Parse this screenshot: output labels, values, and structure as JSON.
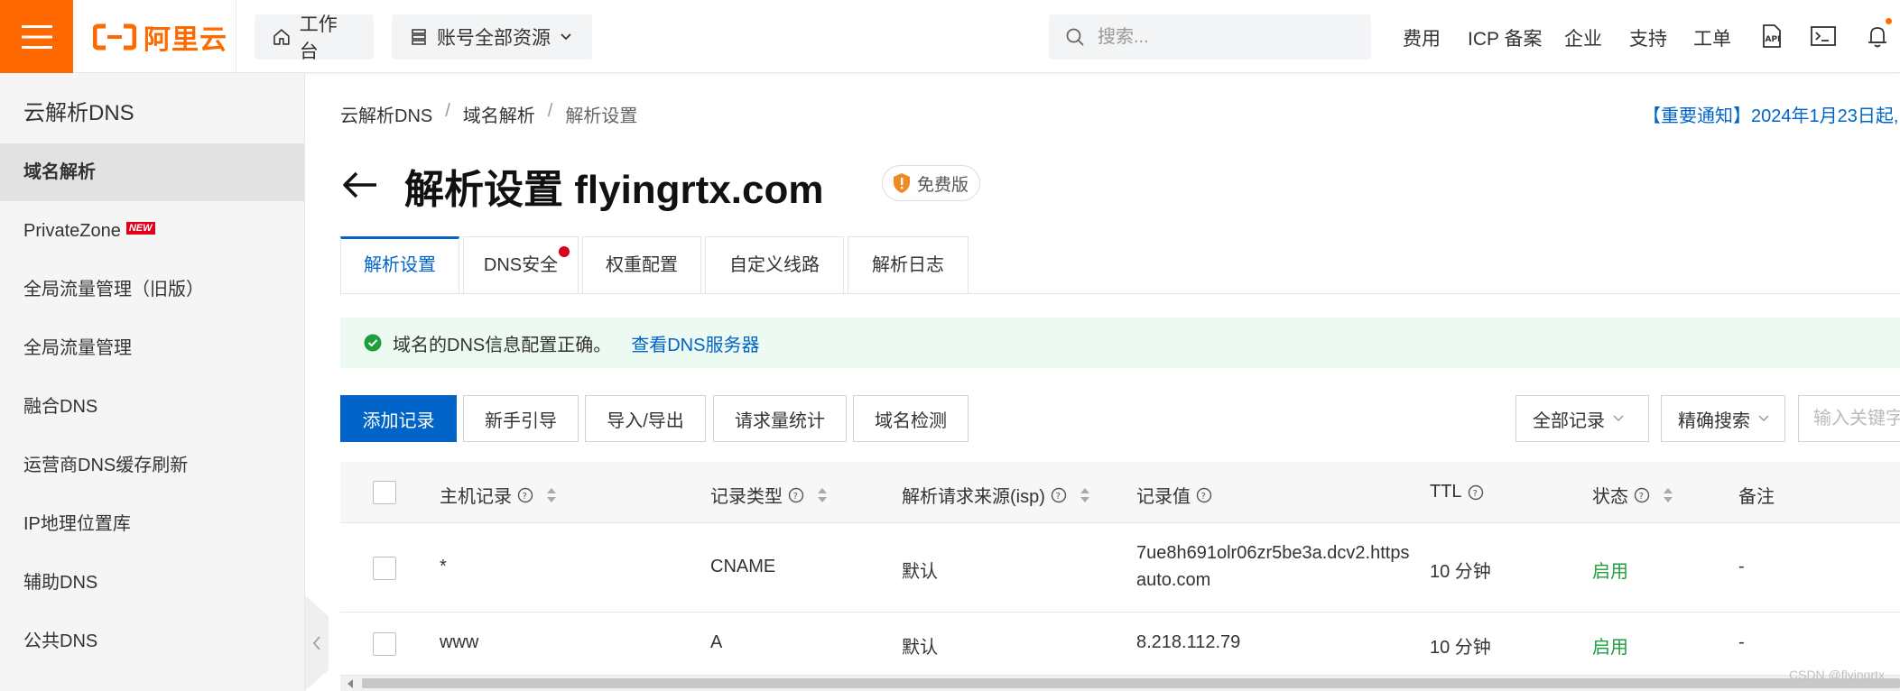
{
  "brand": {
    "logo_text": "阿里云",
    "color": "#ff6a00"
  },
  "topbar": {
    "workbench": "工作台",
    "resources": "账号全部资源",
    "search_placeholder": "搜索...",
    "links": [
      "费用",
      "ICP 备案",
      "企业",
      "支持",
      "工单"
    ],
    "icons": [
      "api-icon",
      "terminal-icon",
      "bell-icon"
    ]
  },
  "sidebar": {
    "title": "云解析DNS",
    "items": [
      {
        "label": "域名解析",
        "active": true
      },
      {
        "label": "PrivateZone",
        "badge": "NEW"
      },
      {
        "label": "全局流量管理（旧版）"
      },
      {
        "label": "全局流量管理"
      },
      {
        "label": "融合DNS"
      },
      {
        "label": "运营商DNS缓存刷新"
      },
      {
        "label": "IP地理位置库"
      },
      {
        "label": "辅助DNS"
      },
      {
        "label": "公共DNS"
      }
    ]
  },
  "breadcrumb": [
    "云解析DNS",
    "域名解析",
    "解析设置"
  ],
  "notice": "【重要通知】2024年1月23日起,",
  "page": {
    "title": "解析设置 flyingrtx.com",
    "badge": "免费版"
  },
  "tabs": [
    "解析设置",
    "DNS安全",
    "权重配置",
    "自定义线路",
    "解析日志"
  ],
  "alert": {
    "text": "域名的DNS信息配置正确。",
    "link": "查看DNS服务器"
  },
  "toolbar": {
    "buttons": [
      "添加记录",
      "新手引导",
      "导入/导出",
      "请求量统计",
      "域名检测"
    ],
    "filter_select": "全部记录",
    "search_mode": "精确搜索",
    "keyword_placeholder": "输入关键字"
  },
  "table": {
    "columns": [
      "主机记录",
      "记录类型",
      "解析请求来源(isp)",
      "记录值",
      "TTL",
      "状态",
      "备注"
    ],
    "rows": [
      {
        "host": "*",
        "type": "CNAME",
        "isp": "默认",
        "value_line1": "7ue8h691olr06zr5be3a.dcv2.https",
        "value_line2": "auto.com",
        "ttl": "10 分钟",
        "status": "启用",
        "remark": "-"
      },
      {
        "host": "www",
        "type": "A",
        "isp": "默认",
        "value_line1": "8.218.112.79",
        "value_line2": "",
        "ttl": "10 分钟",
        "status": "启用",
        "remark": "-"
      }
    ]
  },
  "watermark": "CSDN @flyingrtx",
  "colors": {
    "primary": "#0064c8",
    "success": "#1f9e3c",
    "alert_bg": "#edfaf1",
    "tab_dot": "#d9001b"
  }
}
